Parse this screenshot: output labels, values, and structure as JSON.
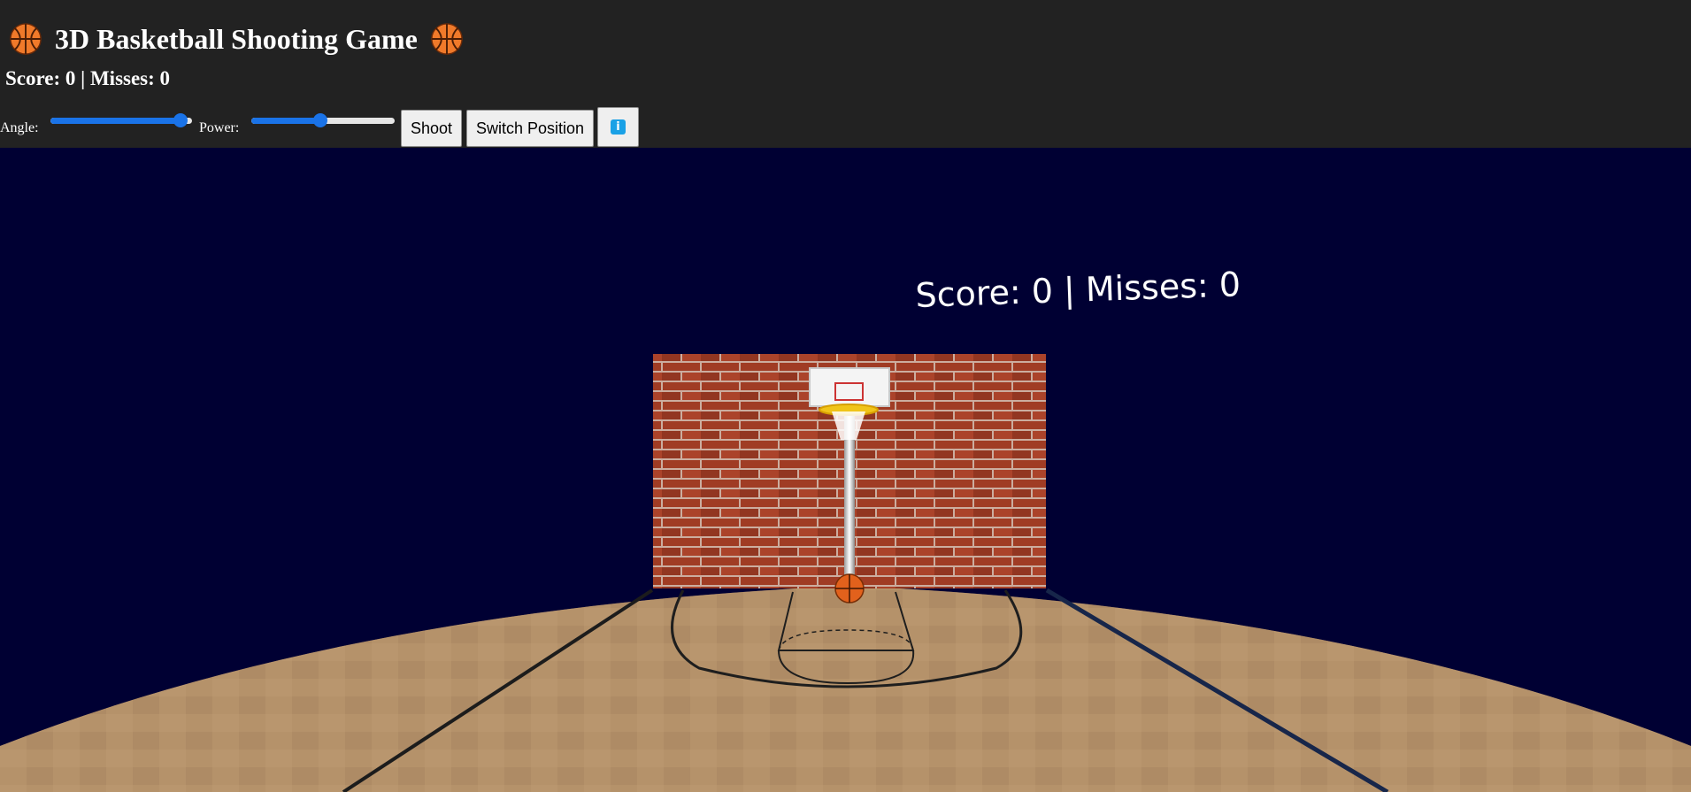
{
  "header": {
    "title": "3D Basketball Shooting Game",
    "title_icon_left": "basketball-icon",
    "title_icon_right": "basketball-icon",
    "score_line": "Score: 0 | Misses: 0"
  },
  "controls": {
    "angle_label": "Angle:",
    "angle_value": 0.92,
    "power_label": "Power:",
    "power_value": 0.48,
    "shoot_label": "Shoot",
    "switch_label": "Switch Position",
    "info_icon": "info-icon",
    "info_glyph": "i",
    "slider_color": "#1a73e8"
  },
  "scene": {
    "hud_text": "Score: 0 | Misses: 0",
    "sky_color": "#000033",
    "floor_color": "#b39069",
    "brick_color": "#9b3a25",
    "ball_color": "#e2611c"
  }
}
